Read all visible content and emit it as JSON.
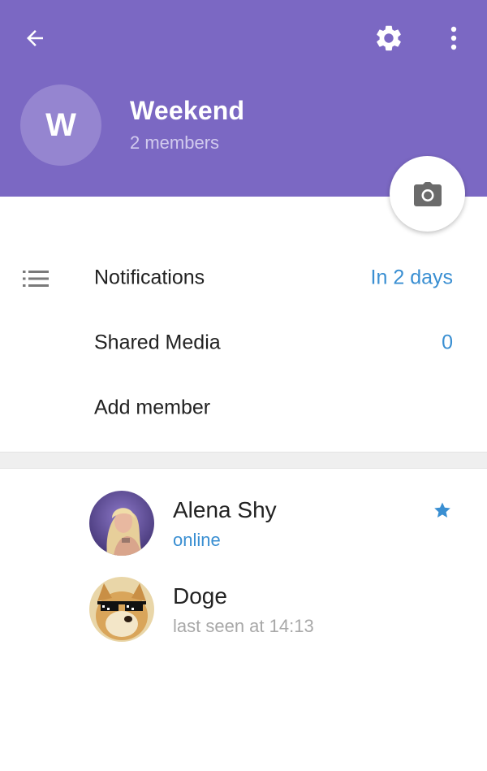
{
  "header": {
    "back_icon": "arrow-left-icon",
    "settings_icon": "gear-icon",
    "more_icon": "more-vertical-icon",
    "background_color": "#7b68c3"
  },
  "group": {
    "avatar_letter": "W",
    "title": "Weekend",
    "subtitle": "2 members"
  },
  "camera_button": {
    "icon": "camera-icon"
  },
  "settings_rows": {
    "notifications": {
      "label": "Notifications",
      "value": "In 2 days"
    },
    "shared_media": {
      "label": "Shared Media",
      "value": "0"
    },
    "add_member": {
      "label": "Add member"
    }
  },
  "members": [
    {
      "name": "Alena Shy",
      "status": "online",
      "is_admin": true,
      "status_color": "#3a8fd2"
    },
    {
      "name": "Doge",
      "status": "last seen at 14:13",
      "is_admin": false,
      "status_color": "#a8a8a8"
    }
  ],
  "accent_color": "#3a8fd2"
}
